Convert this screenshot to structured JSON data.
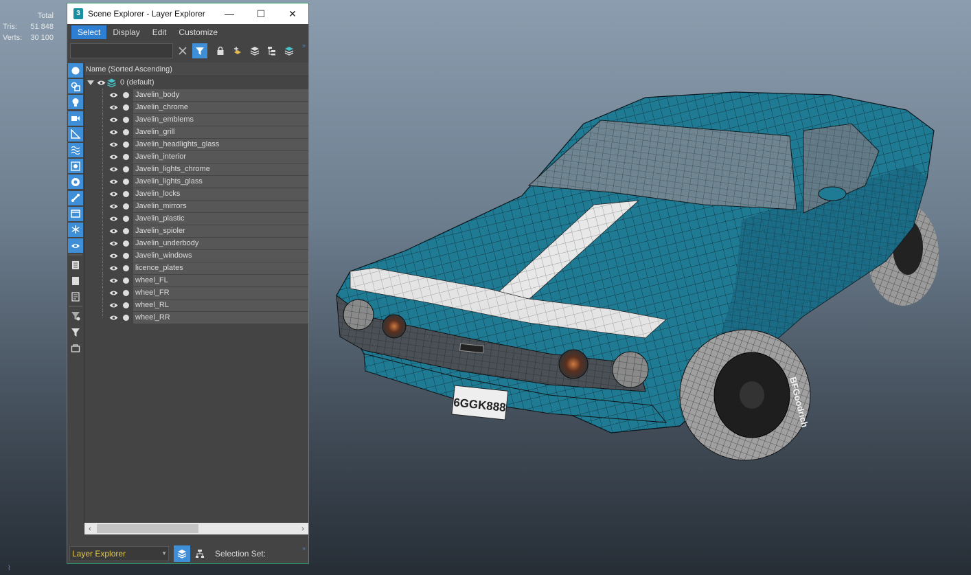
{
  "viewport": {
    "stats": {
      "header": "Total",
      "rows": [
        {
          "label": "Tris:",
          "value": "51 848"
        },
        {
          "label": "Verts:",
          "value": "30 100"
        }
      ]
    },
    "corner_glyph": "⌇",
    "plate_text": "6GGK888",
    "tire_text": "BFGoodrich"
  },
  "window": {
    "title": "Scene Explorer - Layer Explorer",
    "app_icon_text": "3",
    "controls": {
      "minimize": "—",
      "maximize": "☐",
      "close": "✕"
    },
    "menu": [
      "Select",
      "Display",
      "Edit",
      "Customize"
    ],
    "active_menu": "Select",
    "search": {
      "value": "",
      "placeholder": ""
    },
    "tree_header": "Name (Sorted Ascending)",
    "layer": {
      "name": "0 (default)"
    },
    "objects": [
      "Javelin_body",
      "Javelin_chrome",
      "Javelin_emblems",
      "Javelin_grill",
      "Javelin_headlights_glass",
      "Javelin_interior",
      "Javelin_lights_chrome",
      "Javelin_lights_glass",
      "Javelin_locks",
      "Javelin_mirrors",
      "Javelin_plastic",
      "Javelin_spioler",
      "Javelin_underbody",
      "Javelin_windows",
      "licence_plates",
      "wheel_FL",
      "wheel_FR",
      "wheel_RL",
      "wheel_RR"
    ],
    "status": {
      "explorer_mode": "Layer Explorer",
      "selection_set_label": "Selection Set:"
    }
  },
  "colors": {
    "accent": "#3f8fd8",
    "car_paint": "#1f7a93",
    "window_border": "#2b9a6b",
    "dropdown_text": "#e2c94c"
  }
}
